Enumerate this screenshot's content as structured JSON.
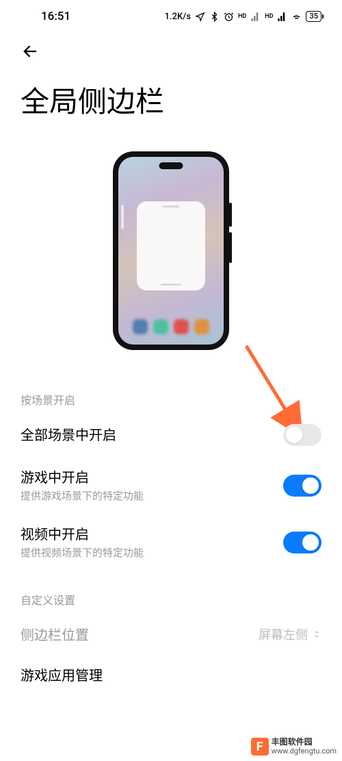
{
  "status": {
    "time": "16:51",
    "speed": "1.2K/s",
    "battery": "35"
  },
  "page": {
    "title": "全局侧边栏"
  },
  "sections": {
    "scene": {
      "header": "按场景开启",
      "items": [
        {
          "title": "全部场景中开启",
          "subtitle": "",
          "enabled": false
        },
        {
          "title": "游戏中开启",
          "subtitle": "提供游戏场景下的特定功能",
          "enabled": true
        },
        {
          "title": "视频中开启",
          "subtitle": "提供视频场景下的特定功能",
          "enabled": true
        }
      ]
    },
    "custom": {
      "header": "自定义设置",
      "position": {
        "label": "侧边栏位置",
        "value": "屏幕左侧"
      },
      "gameApps": {
        "label": "游戏应用管理"
      }
    }
  },
  "watermark": {
    "name": "丰图软件园",
    "url": "www.dgfengtu.com"
  }
}
